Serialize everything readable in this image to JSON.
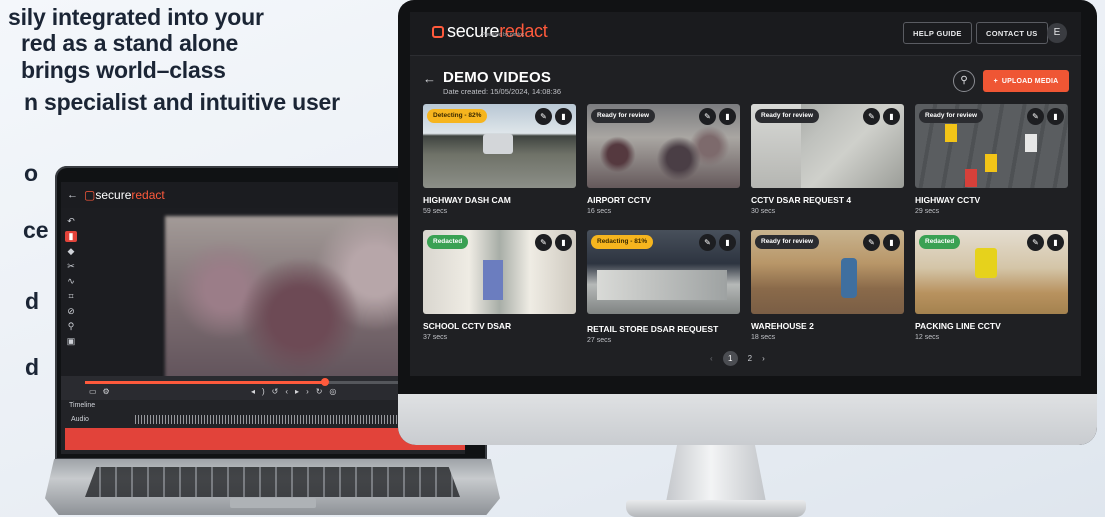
{
  "marketing": {
    "line1": "sily integrated into your",
    "line2": "red as a stand alone",
    "line3": "brings world–class",
    "line4": "n specialist and intuitive user",
    "bullets": [
      "o",
      "ce",
      "d",
      "d"
    ]
  },
  "laptop": {
    "logo_prefix": "secure",
    "logo_accent": "redact",
    "timeline_label": "Timeline",
    "audio_label": "Audio"
  },
  "app": {
    "logo_prefix": "secure",
    "logo_accent": "redact",
    "logo_sub": "Powered by pimloc",
    "help_guide": "HELP GUIDE",
    "contact_us": "CONTACT US",
    "avatar_initial": "E",
    "page_title": "DEMO VIDEOS",
    "date_created": "Date created: 15/05/2024, 14:08:36",
    "upload_media": "UPLOAD MEDIA",
    "upload_plus": "+"
  },
  "videos": [
    {
      "title": "HIGHWAY DASH CAM",
      "duration": "59 secs",
      "status": "Detecting - 82%",
      "status_type": "detecting"
    },
    {
      "title": "AIRPORT CCTV",
      "duration": "16 secs",
      "status": "Ready for review",
      "status_type": "ready"
    },
    {
      "title": "CCTV DSAR REQUEST 4",
      "duration": "30 secs",
      "status": "Ready for review",
      "status_type": "ready"
    },
    {
      "title": "HIGHWAY CCTV",
      "duration": "29 secs",
      "status": "Ready for review",
      "status_type": "ready"
    },
    {
      "title": "SCHOOL CCTV DSAR",
      "duration": "37 secs",
      "status": "Redacted",
      "status_type": "redacted"
    },
    {
      "title": "RETAIL STORE DSAR REQUEST",
      "duration": "27 secs",
      "status": "Redacting - 81%",
      "status_type": "redacting"
    },
    {
      "title": "WAREHOUSE 2",
      "duration": "18 secs",
      "status": "Ready for review",
      "status_type": "ready"
    },
    {
      "title": "PACKING LINE CCTV",
      "duration": "12 secs",
      "status": "Redacted",
      "status_type": "redacted"
    }
  ],
  "pagination": {
    "prev": "‹",
    "pages": [
      "1",
      "2"
    ],
    "current": "1",
    "next": "›"
  },
  "colors": {
    "accent": "#ef5634",
    "detecting": "#f6b51e",
    "redacted": "#3aa153",
    "ready": "#2b2c30"
  },
  "icons": [
    "back-arrow-icon",
    "search-icon",
    "plus-icon",
    "edit-pencil-icon",
    "trash-icon",
    "chevron-left-icon",
    "chevron-right-icon"
  ]
}
